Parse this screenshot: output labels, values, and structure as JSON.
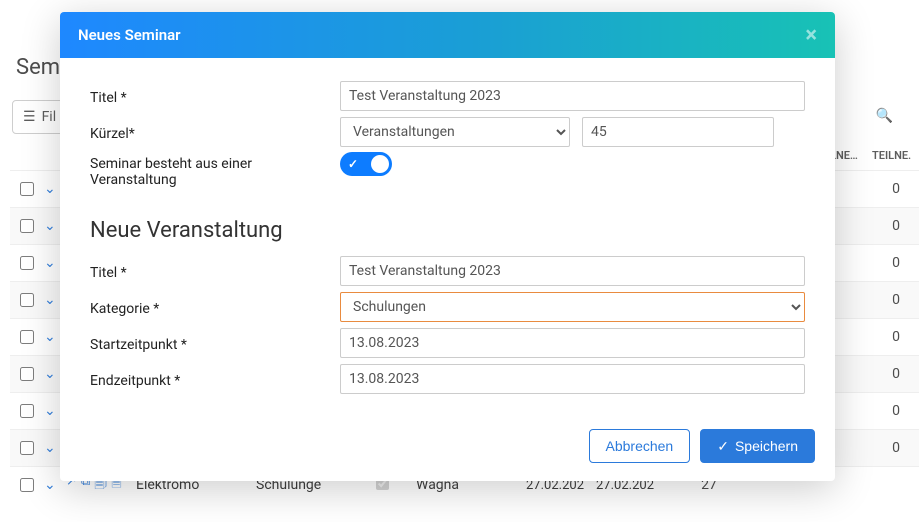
{
  "bg": {
    "title_partial": "Sem",
    "filter_label": "Fil",
    "search_icon": "🔍",
    "columns": {
      "col1": "LNE…",
      "col2": "TEILNE."
    },
    "rows_count_value": "0",
    "last": {
      "name": "Elektromo",
      "category": "Schulunge",
      "location": "Wagna",
      "d1": "27.02.202",
      "d2": "27.02.202",
      "n": "27"
    }
  },
  "modal": {
    "title": "Neues Seminar",
    "seminar": {
      "title_label": "Titel *",
      "title_value": "Test Veranstaltung 2023",
      "kuerzel_label": "Kürzel*",
      "kuerzel_select_value": "Veranstaltungen",
      "kuerzel_number": "45",
      "single_event_label": "Seminar besteht aus einer Veranstaltung"
    },
    "section_heading": "Neue Veranstaltung",
    "event": {
      "title_label": "Titel *",
      "title_value": "Test Veranstaltung 2023",
      "category_label": "Kategorie *",
      "category_value": "Schulungen",
      "start_label": "Startzeitpunkt *",
      "start_value": "13.08.2023",
      "end_label": "Endzeitpunkt *",
      "end_value": "13.08.2023"
    },
    "buttons": {
      "cancel": "Abbrechen",
      "save": "Speichern"
    }
  }
}
